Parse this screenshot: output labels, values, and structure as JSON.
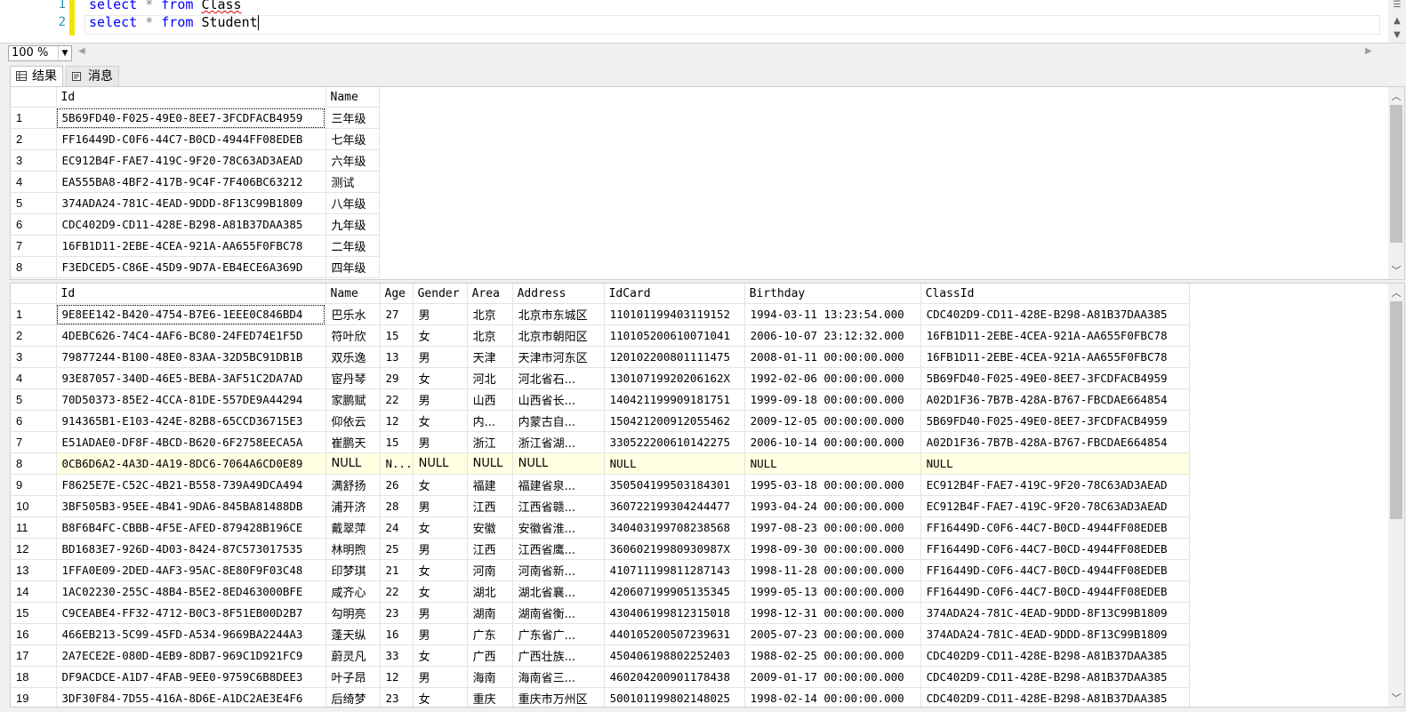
{
  "editor": {
    "line_numbers": [
      "1",
      "2"
    ],
    "line1": {
      "kw1": "select",
      "star": "*",
      "kw2": "from",
      "table": "Class"
    },
    "line2": {
      "kw1": "select",
      "star": "*",
      "kw2": "from",
      "table": "Student"
    }
  },
  "zoom": {
    "value": "100 %"
  },
  "tabs": {
    "results": "结果",
    "messages": "消息"
  },
  "class_grid": {
    "columns": [
      "Id",
      "Name"
    ],
    "rows": [
      [
        "1",
        "5B69FD40-F025-49E0-8EE7-3FCDFACB4959",
        "三年级"
      ],
      [
        "2",
        "FF16449D-C0F6-44C7-B0CD-4944FF08EDEB",
        "七年级"
      ],
      [
        "3",
        "EC912B4F-FAE7-419C-9F20-78C63AD3AEAD",
        "六年级"
      ],
      [
        "4",
        "EA555BA8-4BF2-417B-9C4F-7F406BC63212",
        "测试"
      ],
      [
        "5",
        "374ADA24-781C-4EAD-9DDD-8F13C99B1809",
        "八年级"
      ],
      [
        "6",
        "CDC402D9-CD11-428E-B298-A81B37DAA385",
        "九年级"
      ],
      [
        "7",
        "16FB1D11-2EBE-4CEA-921A-AA655F0FBC78",
        "二年级"
      ],
      [
        "8",
        "F3EDCED5-C86E-45D9-9D7A-EB4ECE6A369D",
        "四年级"
      ]
    ]
  },
  "student_grid": {
    "columns": [
      "Id",
      "Name",
      "Age",
      "Gender",
      "Area",
      "Address",
      "IdCard",
      "Birthday",
      "ClassId"
    ],
    "rows": [
      [
        "1",
        "9E8EE142-B420-4754-B7E6-1EEE0C846BD4",
        "巴乐水",
        "27",
        "男",
        "北京",
        "北京市东城区",
        "110101199403119152",
        "1994-03-11 13:23:54.000",
        "CDC402D9-CD11-428E-B298-A81B37DAA385"
      ],
      [
        "2",
        "4DEBC626-74C4-4AF6-BC80-24FED74E1F5D",
        "符叶欣",
        "15",
        "女",
        "北京",
        "北京市朝阳区",
        "110105200610071041",
        "2006-10-07 23:12:32.000",
        "16FB1D11-2EBE-4CEA-921A-AA655F0FBC78"
      ],
      [
        "3",
        "79877244-B100-48E0-83AA-32D5BC91DB1B",
        "双乐逸",
        "13",
        "男",
        "天津",
        "天津市河东区",
        "120102200801111475",
        "2008-01-11 00:00:00.000",
        "16FB1D11-2EBE-4CEA-921A-AA655F0FBC78"
      ],
      [
        "4",
        "93E87057-340D-46E5-BEBA-3AF51C2DA7AD",
        "宦丹琴",
        "29",
        "女",
        "河北",
        "河北省石...",
        "1301071992020616​2X",
        "1992-02-06 00:00:00.000",
        "5B69FD40-F025-49E0-8EE7-3FCDFACB4959"
      ],
      [
        "5",
        "70D50373-85E2-4CCA-81DE-557DE9A44294",
        "家鹏赋",
        "22",
        "男",
        "山西",
        "山西省长...",
        "140421199909181751",
        "1999-09-18 00:00:00.000",
        "A02D1F36-7B7B-428A-B767-FBCDAE664854"
      ],
      [
        "6",
        "914365B1-E103-424E-82B8-65CCD36715E3",
        "仰依云",
        "12",
        "女",
        "内...",
        "内蒙古自...",
        "150421200912055462",
        "2009-12-05 00:00:00.000",
        "5B69FD40-F025-49E0-8EE7-3FCDFACB4959"
      ],
      [
        "7",
        "E51ADAE0-DF8F-4BCD-B620-6F2758EECA5A",
        "崔鹏天",
        "15",
        "男",
        "浙江",
        "浙江省湖...",
        "330522200610142275",
        "2006-10-14 00:00:00.000",
        "A02D1F36-7B7B-428A-B767-FBCDAE664854"
      ],
      [
        "8",
        "0CB6D6A2-4A3D-4A19-8DC6-7064A6CD0E89",
        "NULL",
        "N...",
        "NULL",
        "NULL",
        "NULL",
        "NULL",
        "NULL",
        "NULL"
      ],
      [
        "9",
        "F8625E7E-C52C-4B21-B558-739A49DCA494",
        "满舒扬",
        "26",
        "女",
        "福建",
        "福建省泉...",
        "350504199503184301",
        "1995-03-18 00:00:00.000",
        "EC912B4F-FAE7-419C-9F20-78C63AD3AEAD"
      ],
      [
        "10",
        "3BF505B3-95EE-4B41-9DA6-845BA81488DB",
        "浦开济",
        "28",
        "男",
        "江西",
        "江西省赣...",
        "360722199304244477",
        "1993-04-24 00:00:00.000",
        "EC912B4F-FAE7-419C-9F20-78C63AD3AEAD"
      ],
      [
        "11",
        "B8F6B4FC-CBBB-4F5E-AFED-879428B196CE",
        "戴翠萍",
        "24",
        "女",
        "安徽",
        "安徽省淮...",
        "340403199708238568",
        "1997-08-23 00:00:00.000",
        "FF16449D-C0F6-44C7-B0CD-4944FF08EDEB"
      ],
      [
        "12",
        "BD1683E7-926D-4D03-8424-87C573017535",
        "林明煦",
        "25",
        "男",
        "江西",
        "江西省鹰...",
        "36060219980930987X",
        "1998-09-30 00:00:00.000",
        "FF16449D-C0F6-44C7-B0CD-4944FF08EDEB"
      ],
      [
        "13",
        "1FFA0E09-2DED-4AF3-95AC-8E80F9F03C48",
        "印梦琪",
        "21",
        "女",
        "河南",
        "河南省新...",
        "410711199811287143",
        "1998-11-28 00:00:00.000",
        "FF16449D-C0F6-44C7-B0CD-4944FF08EDEB"
      ],
      [
        "14",
        "1AC02230-255C-48B4-B5E2-8ED463000BFE",
        "咸齐心",
        "22",
        "女",
        "湖北",
        "湖北省襄...",
        "420607199905135345",
        "1999-05-13 00:00:00.000",
        "FF16449D-C0F6-44C7-B0CD-4944FF08EDEB"
      ],
      [
        "15",
        "C9CEABE4-FF32-4712-B0C3-8F51EB00D2B7",
        "勾明亮",
        "23",
        "男",
        "湖南",
        "湖南省衡...",
        "430406199812315018",
        "1998-12-31 00:00:00.000",
        "374ADA24-781C-4EAD-9DDD-8F13C99B1809"
      ],
      [
        "16",
        "466EB213-5C99-45FD-A534-9669BA2244A3",
        "蓬天纵",
        "16",
        "男",
        "广东",
        "广东省广...",
        "440105200507239631",
        "2005-07-23 00:00:00.000",
        "374ADA24-781C-4EAD-9DDD-8F13C99B1809"
      ],
      [
        "17",
        "2A7ECE2E-080D-4EB9-8DB7-969C1D921FC9",
        "蔚灵凡",
        "33",
        "女",
        "广西",
        "广西壮族...",
        "450406198802252403",
        "1988-02-25 00:00:00.000",
        "CDC402D9-CD11-428E-B298-A81B37DAA385"
      ],
      [
        "18",
        "DF9ACDCE-A1D7-4FAB-9EE0-9759C6B8DEE3",
        "叶子昂",
        "12",
        "男",
        "海南",
        "海南省三...",
        "460204200901178438",
        "2009-01-17 00:00:00.000",
        "CDC402D9-CD11-428E-B298-A81B37DAA385"
      ],
      [
        "19",
        "3DF30F84-7D55-416A-8D6E-A1DC2AE3E4F6",
        "后绮梦",
        "23",
        "女",
        "重庆",
        "重庆市万州区",
        "500101199802148025",
        "1998-02-14 00:00:00.000",
        "CDC402D9-CD11-428E-B298-A81B37DAA385"
      ]
    ]
  }
}
